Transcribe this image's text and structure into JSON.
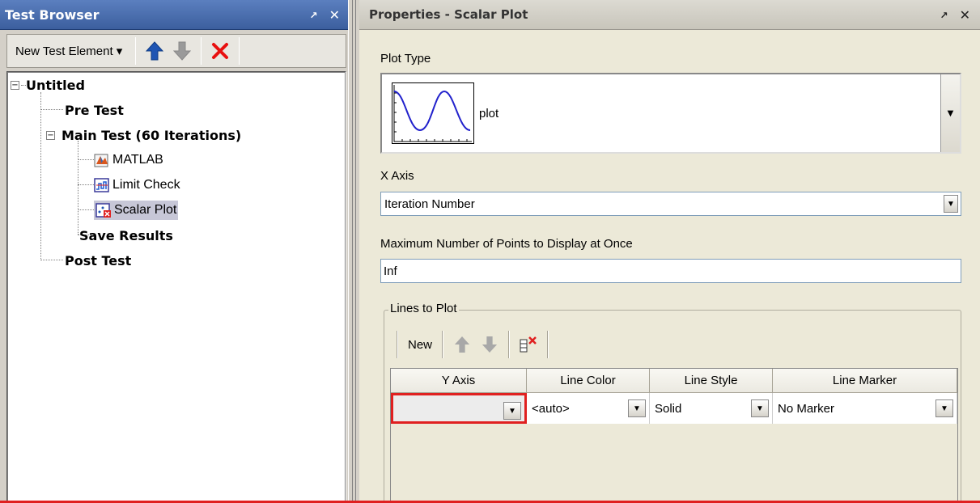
{
  "left_panel": {
    "title": "Test Browser",
    "title_controls": {
      "undock": "↗",
      "close": "✕"
    },
    "toolbar": {
      "new_element_label": "New Test Element ▾",
      "move_up_icon": "arrow-up-icon",
      "move_down_icon": "arrow-down-icon",
      "delete_icon": "delete-icon"
    },
    "tree": {
      "root": {
        "label": "Untitled",
        "expanded": true
      },
      "pre_test": "Pre Test",
      "main_test": {
        "label": "Main Test (60 Iterations)",
        "expanded": true
      },
      "children": [
        "MATLAB",
        "Limit Check",
        "Scalar Plot"
      ],
      "save_results": "Save Results",
      "post_test": "Post Test",
      "selected": "Scalar Plot"
    }
  },
  "right_panel": {
    "title": "Properties - Scalar Plot",
    "title_controls": {
      "undock": "↗",
      "close": "✕"
    },
    "plot_type": {
      "label": "Plot Type",
      "value": "plot"
    },
    "x_axis": {
      "label": "X Axis",
      "value": "Iteration Number"
    },
    "max_points": {
      "label": "Maximum Number of Points to Display at Once",
      "value": "Inf"
    },
    "lines": {
      "group_label": "Lines to Plot",
      "new_label": "New",
      "columns": [
        "Y Axis",
        "Line Color",
        "Line Style",
        "Line Marker"
      ],
      "rows": [
        {
          "y_axis": "",
          "line_color": "<auto>",
          "line_style": "Solid",
          "line_marker": "No Marker"
        }
      ]
    }
  },
  "colors": {
    "title_active": "#3c5f9e",
    "selection": "#c7c7d7",
    "error_border": "#e02020",
    "delete_red": "#e81010",
    "arrow_blue": "#1f55b3"
  }
}
